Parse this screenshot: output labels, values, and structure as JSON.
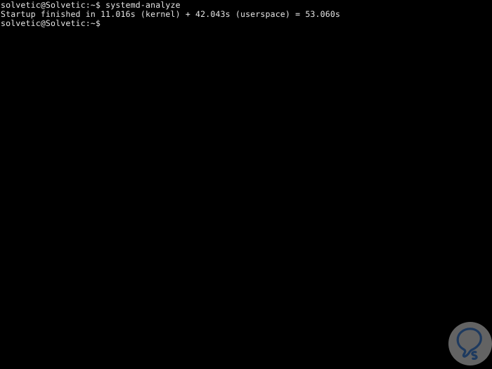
{
  "terminal": {
    "background_color": "#000000",
    "text_color": "#e6e6e6",
    "lines": [
      {
        "id": "command-line",
        "text": "solvetic@Solvetic:~$ systemd-analyze",
        "prompt": "solvetic@Solvetic:~$",
        "command": "systemd-analyze"
      },
      {
        "id": "output-line",
        "text": "Startup finished in 11.016s (kernel) + 42.043s (userspace) = 53.060s",
        "kernel_time": "11.016s",
        "userspace_time": "42.043s",
        "total_time": "53.060s"
      },
      {
        "id": "prompt-line",
        "text": "solvetic@Solvetic:~$",
        "prompt": "solvetic@Solvetic:~$",
        "command": ""
      }
    ]
  },
  "watermark": {
    "name": "solvetic-logo",
    "circle_color": "#636363",
    "mark_color": "#1e3a5f"
  }
}
